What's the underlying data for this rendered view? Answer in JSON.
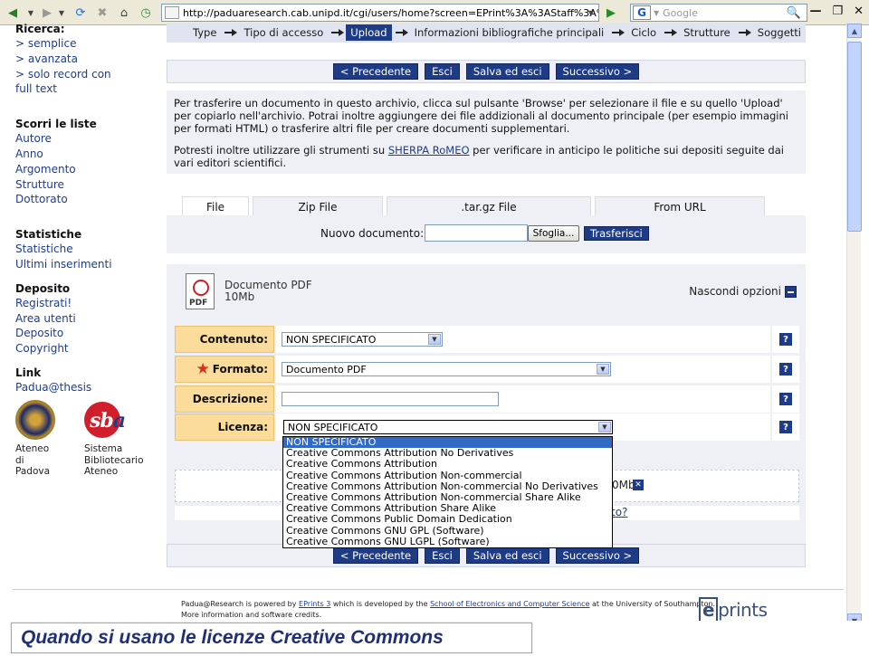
{
  "browser": {
    "url": "http://paduaresearch.cab.unipd.it/cgi/users/home?screen=EPrint%3A%3AStaff%3A%3AEdit&ep",
    "search_placeholder": "Google"
  },
  "sidebar": {
    "search_title": "Ricerca:",
    "search_links": [
      "> semplice",
      "> avanzata",
      "> solo record con",
      "full text"
    ],
    "browse_title": "Scorri le liste",
    "browse_links": [
      "Autore",
      "Anno",
      "Argomento",
      "Strutture",
      "Dottorato"
    ],
    "stats_title": "Statistiche",
    "stats_links": [
      "Statistiche",
      "Ultimi inserimenti"
    ],
    "deposit_title": "Deposito",
    "deposit_links": [
      "Registrati!",
      "Area utenti",
      "Deposito",
      "Copyright"
    ],
    "link_title": "Link",
    "link_links": [
      "Padua@thesis"
    ],
    "logo1_caption": "Ateneo\ndi\nPadova",
    "logo2_caption": "Sistema\nBibliotecario\nAteneo",
    "logo2_text_sb": "sb",
    "logo2_text_a": "a"
  },
  "steps": [
    "Type",
    "Tipo di accesso",
    "Upload",
    "Informazioni bibliografiche principali",
    "Ciclo",
    "Strutture",
    "Soggetti"
  ],
  "nav_buttons": {
    "prev": "< Precedente",
    "exit": "Esci",
    "save_exit": "Salva ed esci",
    "next": "Successivo >"
  },
  "info": {
    "p1": "Per trasferire un documento in questo archivio, clicca sul pulsante 'Browse' per selezionare il file e su quello 'Upload' per copiarlo nell'archivio. Potrai inoltre aggiungere dei file addizionali al documento principale (per esempio immagini per formati HTML) o trasferire altri file per creare documenti supplementari.",
    "p2_pre": "Potresti inoltre utilizzare gli strumenti su ",
    "p2_link": "SHERPA RoMEO",
    "p2_post": " per verificare in anticipo le politiche sui depositi seguite dai vari editori scientifici."
  },
  "upload_tabs": [
    "File",
    "Zip File",
    ".tar.gz File",
    "From URL"
  ],
  "upload": {
    "label": "Nuovo documento:",
    "browse": "Sfoglia...",
    "upload": "Trasferisci"
  },
  "document": {
    "icon_label": "PDF",
    "type": "Documento PDF",
    "size": "10Mb",
    "hide_options": "Nascondi opzioni"
  },
  "fields": {
    "contenuto_label": "Contenuto:",
    "contenuto_value": "NON SPECIFICATO",
    "formato_label": "Formato:",
    "formato_value": "Documento PDF",
    "descrizione_label": "Descrizione:",
    "licenza_label": "Licenza:",
    "licenza_value": "NON SPECIFICATO",
    "help": "?"
  },
  "license_options": [
    "NON SPECIFICATO",
    "Creative Commons Attribution No Derivatives",
    "Creative Commons Attribution",
    "Creative Commons Attribution Non-commercial",
    "Creative Commons Attribution Non-commercial No Derivatives",
    "Creative Commons Attribution Non-commercial Share Alike",
    "Creative Commons Attribution Share Alike",
    "Creative Commons Public Domain Dedication",
    "Creative Commons GNU GPL (Software)",
    "Creative Commons GNU LGPL (Software)"
  ],
  "partial": {
    "size_fragment": "0Mb",
    "link_fragment": "to?"
  },
  "footer": {
    "line1_a": "Padua@Research is powered by ",
    "line1_link1": "EPrints 3",
    "line1_b": " which is developed by the ",
    "line1_link2": "School of Electronics and Computer Science",
    "line1_c": " at the University of Southampton.",
    "line2": "More information and software credits.",
    "logo_e": "e",
    "logo_rest": "prints"
  },
  "caption": "Quando si usano le licenze Creative Commons"
}
